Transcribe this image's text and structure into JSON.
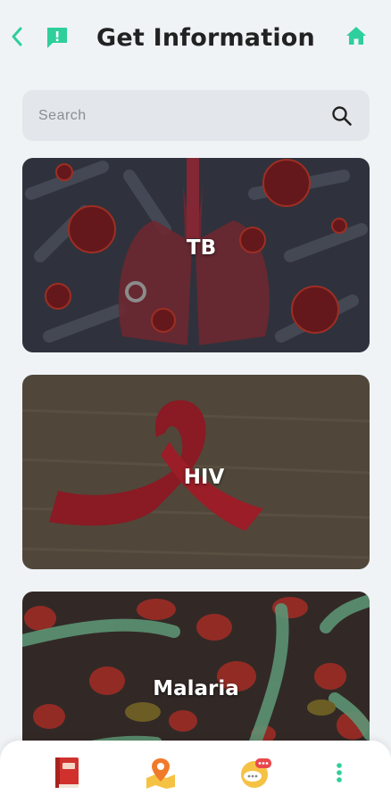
{
  "header": {
    "title": "Get Information",
    "accent_color": "#2ecf9a"
  },
  "search": {
    "placeholder": "Search"
  },
  "cards": [
    {
      "label": "TB"
    },
    {
      "label": "HIV"
    },
    {
      "label": "Malaria"
    }
  ],
  "bottom_nav": {
    "items": [
      "book-icon",
      "map-pin-icon",
      "chat-icon",
      "more-vertical-icon"
    ]
  }
}
